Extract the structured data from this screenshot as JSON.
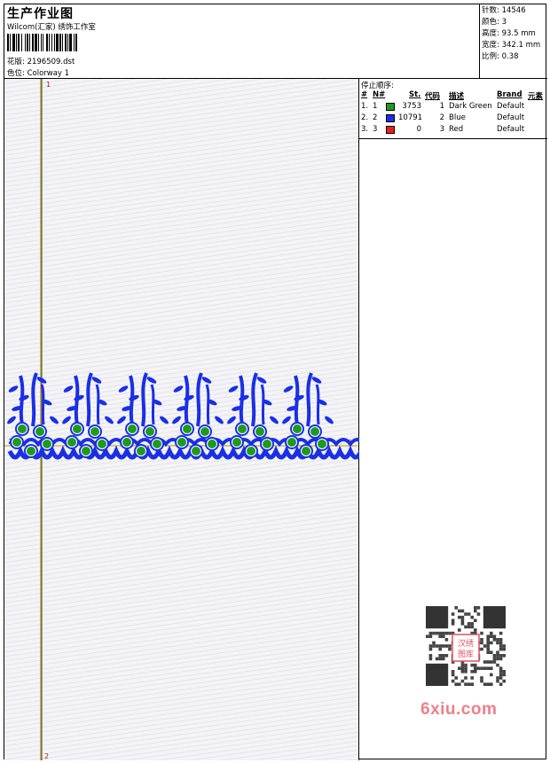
{
  "header": {
    "title": "生产作业图",
    "company": "Wilcom(汇家) 绣饰工作室",
    "design_label": "花版:",
    "design_value": "2196509.dst",
    "colorway_label": "色位:",
    "colorway_value": "Colorway 1"
  },
  "stats": {
    "stitches_label": "针数:",
    "stitches_value": "14546",
    "colors_label": "颜色:",
    "colors_value": "3",
    "height_label": "高度:",
    "height_value": "93.5 mm",
    "width_label": "宽度:",
    "width_value": "342.1 mm",
    "scale_label": "比例:",
    "scale_value": "0.38"
  },
  "stop_sequence": {
    "title": "停止顺序:",
    "columns": [
      "#",
      "N#",
      "St.",
      "代码",
      "描述",
      "Brand",
      "元素"
    ],
    "rows": [
      {
        "idx": "1.",
        "n": "1",
        "color": "#1f9a1f",
        "st": "3753",
        "code": "1",
        "desc": "Dark Green",
        "brand": "Default"
      },
      {
        "idx": "2.",
        "n": "2",
        "color": "#1a2fe6",
        "st": "10791",
        "code": "2",
        "desc": "Blue",
        "brand": "Default"
      },
      {
        "idx": "3.",
        "n": "3",
        "color": "#ee1c1c",
        "st": "0",
        "code": "3",
        "desc": "Red",
        "brand": "Default"
      }
    ]
  },
  "markers": {
    "top": "1",
    "bottom": "2",
    "left": "1",
    "right": "2"
  },
  "watermark": {
    "site": "6xiu.com",
    "stamp_line1": "汉绣",
    "stamp_line2": "图库"
  }
}
